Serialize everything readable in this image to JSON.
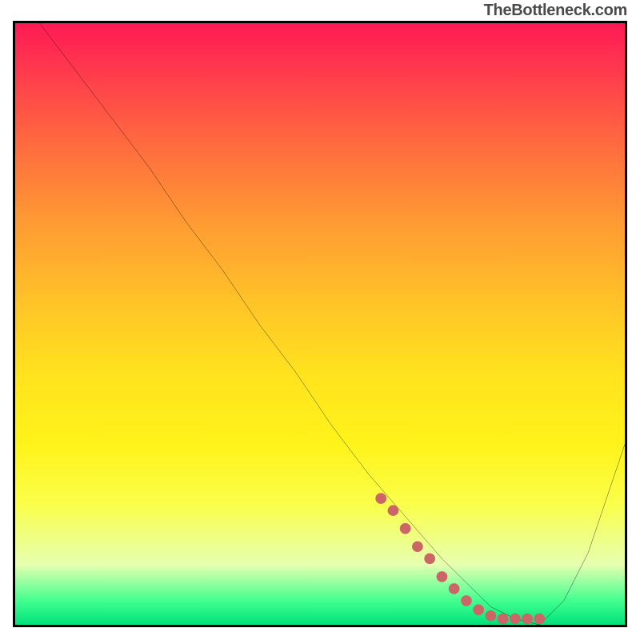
{
  "watermark": "TheBottleneck.com",
  "chart_data": {
    "type": "line",
    "title": "",
    "xlabel": "",
    "ylabel": "",
    "xlim": [
      0,
      100
    ],
    "ylim": [
      0,
      100
    ],
    "grid": false,
    "legend": "none",
    "series": [
      {
        "name": "bottleneck-curve",
        "color": "#000000",
        "x": [
          0,
          4,
          10,
          16,
          22,
          28,
          34,
          40,
          46,
          52,
          58,
          64,
          70,
          74,
          78,
          82,
          86,
          90,
          94,
          100
        ],
        "y": [
          104,
          100,
          92,
          84,
          76,
          67,
          59,
          50,
          42,
          33,
          25,
          18,
          11,
          7,
          3,
          1,
          0,
          4,
          12,
          30
        ]
      },
      {
        "name": "highlight-dots",
        "color": "#cc6666",
        "type": "scatter",
        "x": [
          60,
          62,
          64,
          66,
          68,
          70,
          72,
          74,
          76,
          78,
          80,
          82,
          84,
          86
        ],
        "y": [
          21,
          19,
          16,
          13,
          11,
          8,
          6,
          4,
          2.5,
          1.5,
          1,
          1,
          1,
          1
        ]
      }
    ],
    "background_gradient": {
      "direction": "vertical",
      "stops": [
        {
          "pos": 0.0,
          "color": "#ff1a55"
        },
        {
          "pos": 0.2,
          "color": "#ff6a3f"
        },
        {
          "pos": 0.46,
          "color": "#ffc228"
        },
        {
          "pos": 0.7,
          "color": "#fff31a"
        },
        {
          "pos": 0.9,
          "color": "#e6ffb0"
        },
        {
          "pos": 1.0,
          "color": "#00e27a"
        }
      ]
    }
  }
}
